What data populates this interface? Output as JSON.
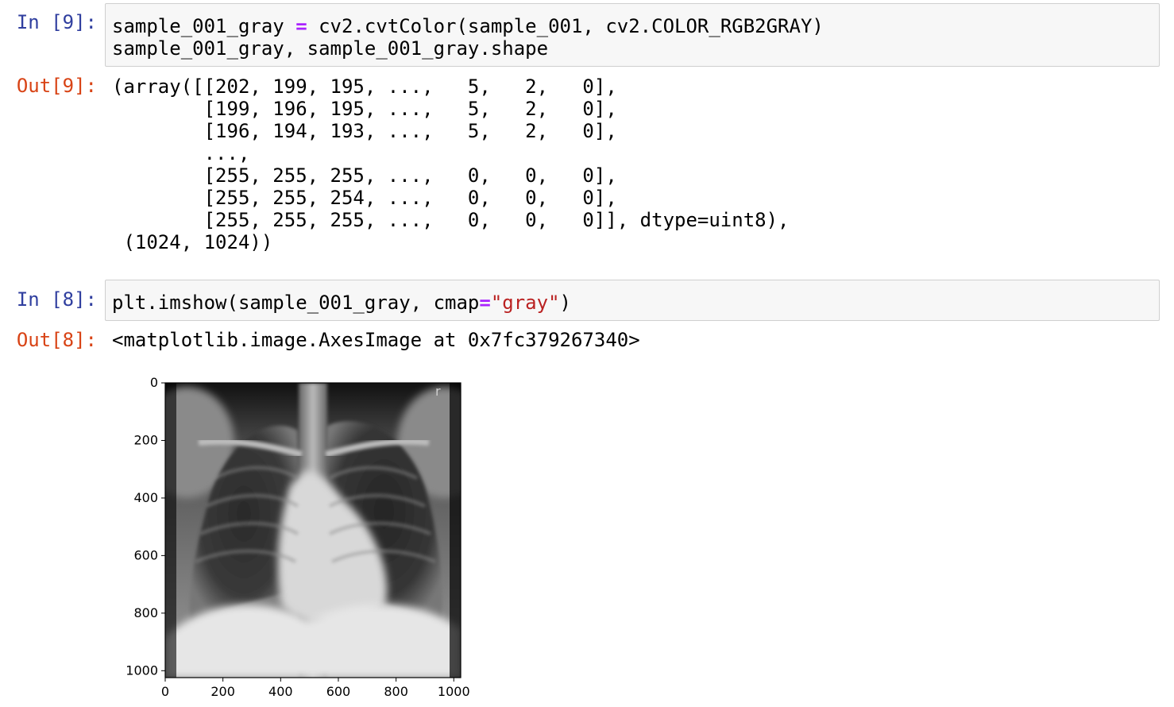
{
  "cells": [
    {
      "in_prompt": "In [9]:",
      "code_line1_a": "sample_001_gray ",
      "code_line1_op": "=",
      "code_line1_b": " cv2.cvtColor(sample_001, cv2.COLOR_RGB2GRAY)",
      "code_line2": "sample_001_gray, sample_001_gray.shape",
      "out_prompt": "Out[9]:",
      "output": "(array([[202, 199, 195, ...,   5,   2,   0],\n        [199, 196, 195, ...,   5,   2,   0],\n        [196, 194, 193, ...,   5,   2,   0],\n        ...,\n        [255, 255, 255, ...,   0,   0,   0],\n        [255, 255, 254, ...,   0,   0,   0],\n        [255, 255, 255, ...,   0,   0,   0]], dtype=uint8),\n (1024, 1024))"
    },
    {
      "in_prompt": "In [8]:",
      "code_a": "plt.imshow(sample_001_gray, cmap",
      "code_op": "=",
      "code_str": "\"gray\"",
      "code_b": ")",
      "out_prompt": "Out[8]:",
      "output": "<matplotlib.image.AxesImage at 0x7fc379267340>"
    }
  ],
  "plot": {
    "image_subject": "chest-xray",
    "corner_marker": "r",
    "xticks": [
      0,
      200,
      400,
      600,
      800,
      1000
    ],
    "yticks": [
      0,
      200,
      400,
      600,
      800,
      1000
    ],
    "xlim": [
      0,
      1024
    ],
    "ylim": [
      0,
      1024
    ]
  }
}
